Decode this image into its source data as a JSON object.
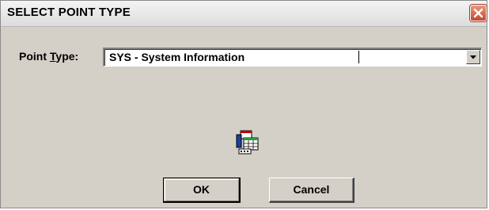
{
  "window": {
    "title": "SELECT POINT TYPE",
    "close_icon": "close-icon"
  },
  "form": {
    "label_prefix": "Point ",
    "label_underlined": "T",
    "label_suffix": "ype:",
    "point_type_value": "SYS - System Information",
    "dropdown_icon": "chevron-down-icon"
  },
  "center_icon": "point-table-icon",
  "buttons": {
    "ok_label": "OK",
    "cancel_label": "Cancel"
  },
  "colors": {
    "dialog_background": "#d4d0c8",
    "close_button": "#c7452a"
  }
}
